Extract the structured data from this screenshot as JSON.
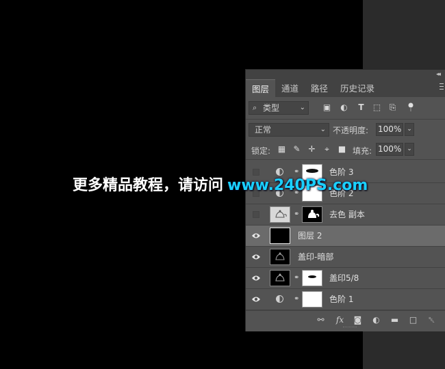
{
  "panel": {
    "tabs": [
      "图层",
      "通道",
      "路径",
      "历史记录"
    ],
    "active_tab": 0,
    "filter": {
      "label": "类型"
    },
    "blend_mode": "正常",
    "opacity_label": "不透明度:",
    "opacity_value": "100%",
    "lock_label": "锁定:",
    "fill_label": "填充:",
    "fill_value": "100%",
    "layers": [
      {
        "name": "色阶 3",
        "visible": false,
        "type": "adjustment",
        "mask": "blob"
      },
      {
        "name": "色阶 2",
        "visible": false,
        "type": "adjustment",
        "mask": "white"
      },
      {
        "name": "去色 副本",
        "visible": false,
        "type": "pixel-masked",
        "mask": "teapot"
      },
      {
        "name": "图层 2",
        "visible": true,
        "type": "pixel",
        "selected": true
      },
      {
        "name": "盖印-暗部",
        "visible": true,
        "type": "pixel"
      },
      {
        "name": "盖印5/8",
        "visible": true,
        "type": "pixel-masked",
        "mask": "blob"
      },
      {
        "name": "色阶 1",
        "visible": true,
        "type": "adjustment",
        "mask": "white"
      }
    ]
  },
  "watermark": {
    "text": "更多精品教程，请访问",
    "url": "www.240PS.com"
  },
  "colors": {
    "panel_bg": "#535353",
    "selected_row": "#6b6b6b",
    "watermark_url": "#1ad0ff"
  }
}
